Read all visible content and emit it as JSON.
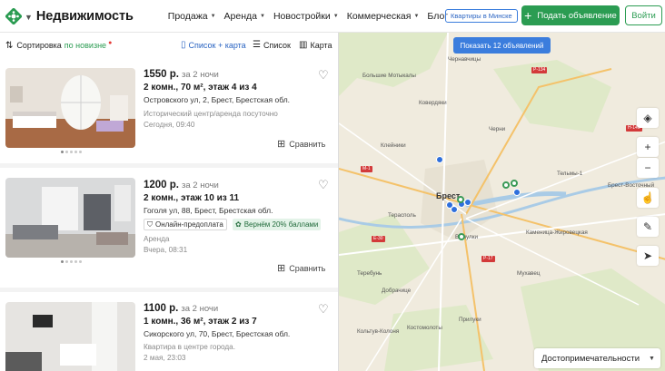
{
  "header": {
    "logo_text": "Недвижимость",
    "nav": [
      "Продажа",
      "Аренда",
      "Новостройки",
      "Коммерческая",
      "Блог"
    ],
    "city_button": "Квартиры в Минске",
    "post_button": "Подать объявление",
    "login_button": "Войти"
  },
  "toolbar": {
    "sort_label": "Сортировка",
    "sort_value": "по новизне",
    "views": [
      "Список + карта",
      "Список",
      "Карта"
    ]
  },
  "listings": [
    {
      "price": "1550 р.",
      "period": "за 2 ночи",
      "rooms": "2 комн., 70 м², этаж 4 из 4",
      "address": "Островского ул, 2, Брест, Брестская обл.",
      "description": "Исторический центр/аренда посуточно",
      "date": "Сегодня, 09:40",
      "compare": "Сравнить"
    },
    {
      "price": "1200 р.",
      "period": "за 2 ночи",
      "rooms": "2 комн., этаж 10 из 11",
      "address": "Гоголя ул, 88, Брест, Брестская обл.",
      "badge_prepay": "Онлайн-предоплата",
      "badge_cashback": "Вернём 20% баллами",
      "description": "Аренда",
      "date": "Вчера, 08:31",
      "compare": "Сравнить"
    },
    {
      "price": "1100 р.",
      "period": "за 2 ночи",
      "rooms": "1 комн., 36 м², этаж 2 из 7",
      "address": "Сикорского ул, 70, Брест, Брестская обл.",
      "description": "Квартира в центре города.",
      "date": "2 мая, 23:03"
    }
  ],
  "map": {
    "show_button": "Показать 12 объявлений",
    "attractions": "Достопримечательности",
    "city": "Брест",
    "labels": [
      "Большие Мотыкалы",
      "Черни",
      "Чернавчицы",
      "Клейники",
      "Ковердяки",
      "Тельмы-1",
      "Брест-Восточный",
      "Терасполь",
      "Каменица-Жировецкая",
      "Вычулки",
      "Мухавец",
      "Прилуки",
      "Костомолоты",
      "Кольтув-Колоня",
      "Добрачице",
      "Теребунь"
    ],
    "road_shields": [
      "Р-134",
      "Н-145",
      "М-1",
      "Е-30",
      "Р-17"
    ]
  },
  "colors": {
    "accent_green": "#2b9c52",
    "accent_blue": "#3b7ddd",
    "map_pin_blue": "#2e6fdc"
  }
}
